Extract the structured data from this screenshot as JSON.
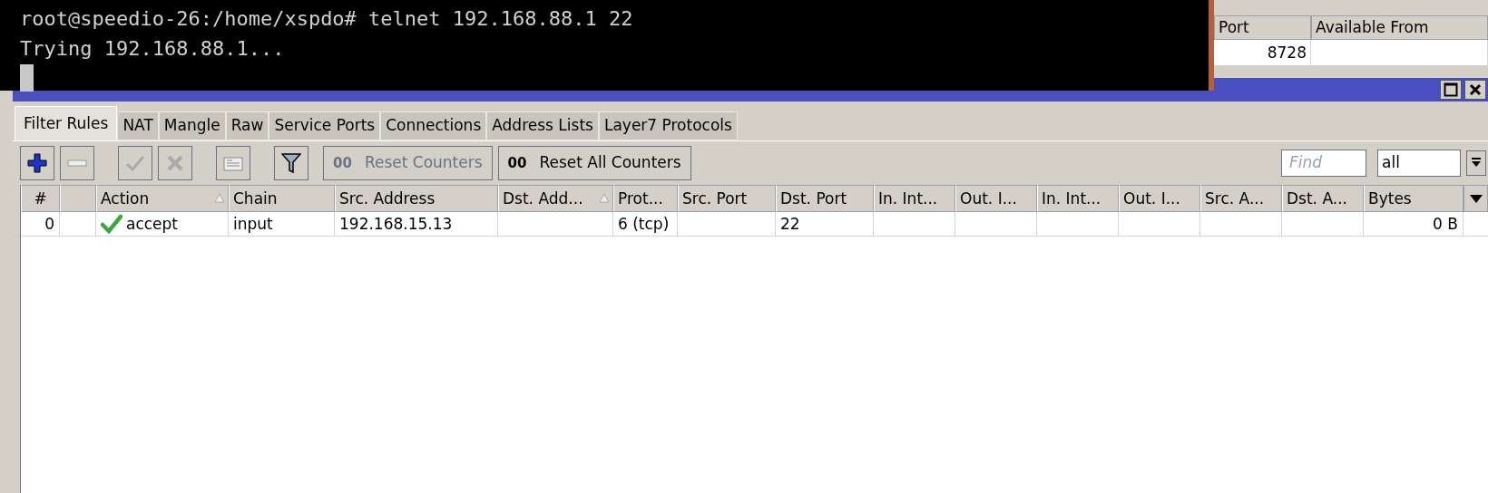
{
  "terminal": {
    "lines": [
      "root@speedio-26:/home/xspdo# telnet 192.168.88.1 22",
      "Trying 192.168.88.1..."
    ]
  },
  "background_window": {
    "columns": [
      "Port",
      "Available From"
    ],
    "rows": [
      [
        "8728",
        null
      ]
    ]
  },
  "firewall": {
    "window_buttons": [
      {
        "kind": "maximize"
      },
      {
        "kind": "close"
      }
    ],
    "tabs": [
      {
        "label": "Filter Rules",
        "selected": true
      },
      {
        "label": "NAT",
        "selected": false
      },
      {
        "label": "Mangle",
        "selected": false
      },
      {
        "label": "Raw",
        "selected": false
      },
      {
        "label": "Service Ports",
        "selected": false
      },
      {
        "label": "Connections",
        "selected": false
      },
      {
        "label": "Address Lists",
        "selected": false
      },
      {
        "label": "Layer7 Protocols",
        "selected": false
      }
    ],
    "toolbar": [
      {
        "kind": "add",
        "disabled": false
      },
      {
        "kind": "remove",
        "disabled": true
      },
      {
        "kind": "enable",
        "disabled": true
      },
      {
        "kind": "disable",
        "disabled": true
      },
      {
        "kind": "comment",
        "disabled": true
      },
      {
        "kind": "filter",
        "disabled": false
      },
      {
        "kind": "text",
        "badge": "00",
        "label": "Reset Counters",
        "disabled": true
      },
      {
        "kind": "text",
        "badge": "00",
        "label": "Reset All Counters",
        "disabled": false
      }
    ],
    "find": {
      "placeholder": "Find"
    },
    "filter_select": {
      "value": "all"
    },
    "table": {
      "columns": [
        {
          "label": "#",
          "sorted": false
        },
        {
          "sorted": false
        },
        {
          "label": "Action",
          "sorted": true
        },
        {
          "label": "Chain",
          "sorted": false
        },
        {
          "label": "Src. Address",
          "sorted": false
        },
        {
          "label": "Dst. Add...",
          "sorted": true
        },
        {
          "label": "Prot...",
          "sorted": false
        },
        {
          "label": "Src. Port",
          "sorted": false
        },
        {
          "label": "Dst. Port",
          "sorted": false
        },
        {
          "label": "In. Int...",
          "sorted": false
        },
        {
          "label": "Out. I...",
          "sorted": false
        },
        {
          "label": "In. Int...",
          "sorted": false
        },
        {
          "label": "Out. I...",
          "sorted": false
        },
        {
          "label": "Src. A...",
          "sorted": false
        },
        {
          "label": "Dst. A...",
          "sorted": false
        },
        {
          "label": "Bytes",
          "sorted": false
        }
      ],
      "rows": [
        {
          "cells": [
            "0",
            null,
            "accept",
            "input",
            "192.168.15.13",
            null,
            "6 (tcp)",
            null,
            "22",
            null,
            null,
            null,
            null,
            null,
            null,
            "0 B"
          ]
        }
      ]
    }
  }
}
